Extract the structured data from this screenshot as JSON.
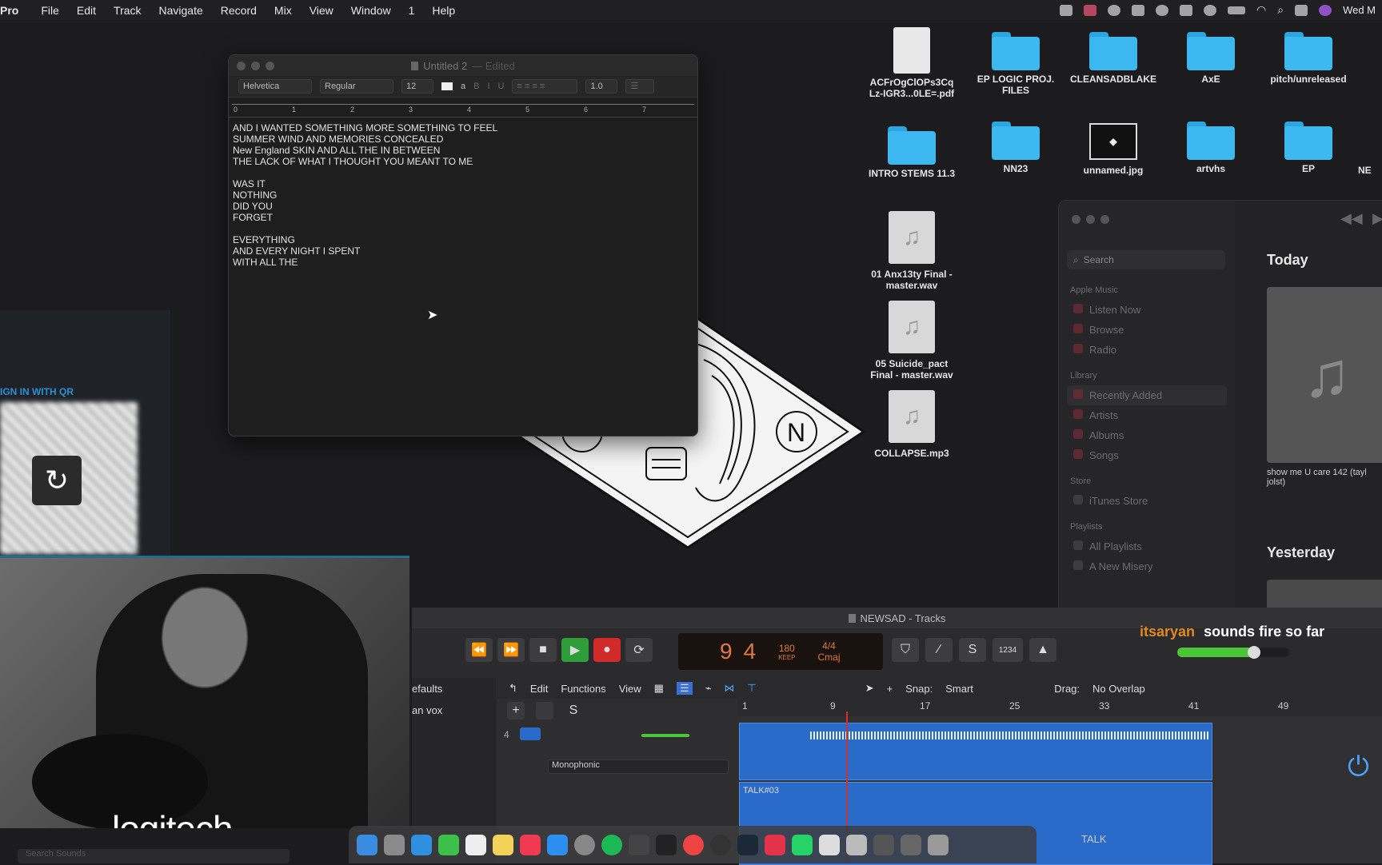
{
  "menubar": {
    "app": "Pro",
    "items": [
      "File",
      "Edit",
      "Track",
      "Navigate",
      "Record",
      "Mix",
      "View",
      "Window",
      "1",
      "Help"
    ],
    "clock": "Wed M"
  },
  "textedit": {
    "title": "Untitled 2",
    "edited": "— Edited",
    "font": "Helvetica",
    "style": "Regular",
    "size": "12",
    "spacing": "1.0",
    "ruler_marks": [
      "0",
      "1",
      "2",
      "3",
      "4",
      "5",
      "6",
      "7"
    ],
    "lines": [
      "AND I WANTED SOMETHING MORE SOMETHING TO FEEL",
      "SUMMER WIND AND MEMORIES CONCEALED",
      "New England SKIN AND ALL THE IN BETWEEN",
      "THE LACK OF WHAT I THOUGHT YOU MEANT TO ME",
      "",
      "WAS IT",
      "NOTHING",
      "DID YOU",
      "FORGET",
      "",
      "EVERYTHING",
      "AND EVERY NIGHT I SPENT",
      "WITH ALL THE"
    ]
  },
  "desktop": {
    "icons": [
      {
        "label": "ACFrOgClOPs3Cq Lz-IGR3...0LE=.pdf",
        "type": "pdf"
      },
      {
        "label": "EP LOGIC PROJ. FILES",
        "type": "folder"
      },
      {
        "label": "CLEANSADBLAKE",
        "type": "folder"
      },
      {
        "label": "AxE",
        "type": "folder"
      },
      {
        "label": "pitch/unreleased",
        "type": "folder"
      },
      {
        "label": "INTRO STEMS 11.3",
        "type": "folder"
      },
      {
        "label": "NN23",
        "type": "folder"
      },
      {
        "label": "unnamed.jpg",
        "type": "image"
      },
      {
        "label": "artvhs",
        "type": "folder"
      },
      {
        "label": "EP",
        "type": "folder"
      },
      {
        "label": "NE",
        "type": "folder"
      },
      {
        "label": "01 Anx13ty Final - master.wav",
        "type": "audio"
      },
      {
        "label": "05 Suicide_pact Final - master.wav",
        "type": "audio"
      },
      {
        "label": "COLLAPSE.mp3",
        "type": "audio"
      }
    ]
  },
  "qr": {
    "label": "IGN IN WITH QR"
  },
  "music": {
    "search_placeholder": "Search",
    "sections": {
      "apple_music": "Apple Music",
      "library": "Library",
      "store": "Store",
      "playlists": "Playlists"
    },
    "apple_music_items": [
      "Listen Now",
      "Browse",
      "Radio"
    ],
    "library_items": [
      "Recently Added",
      "Artists",
      "Albums",
      "Songs"
    ],
    "store_items": [
      "iTunes Store"
    ],
    "playlist_items": [
      "All Playlists",
      "A New Misery"
    ],
    "today": "Today",
    "yesterday": "Yesterday",
    "album_caption": "show me U care 142 (tayl jolst)"
  },
  "logic": {
    "title": "NEWSAD - Tracks",
    "lcd": {
      "bar": "9",
      "beat": "4",
      "tempo": "180",
      "keep": "KEEP",
      "sig": "4/4",
      "key": "Cmaj"
    },
    "count_in": "1234",
    "chat": {
      "user": "itsaryan",
      "message": "sounds fire so far"
    },
    "menus": {
      "edit": "Edit",
      "functions": "Functions",
      "view": "View"
    },
    "snap_label": "Snap:",
    "snap_value": "Smart",
    "drag_label": "Drag:",
    "drag_value": "No Overlap",
    "ruler": [
      "1",
      "9",
      "17",
      "25",
      "33",
      "41",
      "49"
    ],
    "track_number": "4",
    "track_mode": "Monophonic",
    "region_label": "TALK#03",
    "talk_label": "TALK",
    "library_partial": [
      "efaults",
      "an vox"
    ]
  },
  "webcam": {
    "brand": "logitech"
  },
  "dock": {
    "search_placeholder": "Search Sounds"
  }
}
